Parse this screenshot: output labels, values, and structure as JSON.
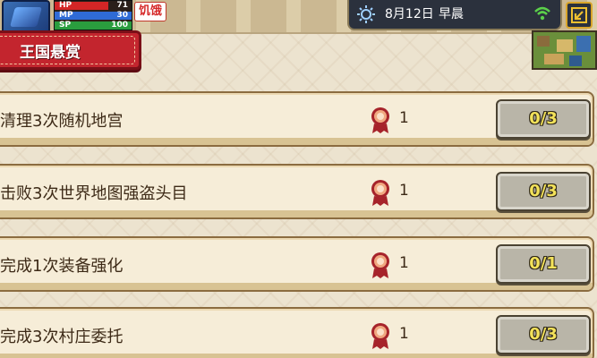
{
  "hud": {
    "hp_label": "HP",
    "hp_value": "71",
    "mp_label": "MP",
    "mp_value": "30",
    "sp_label": "SP",
    "sp_value": "100",
    "hunger": "饥饿"
  },
  "clock": {
    "date": "8月12日",
    "period": "早晨",
    "icon": "sun-icon"
  },
  "panel": {
    "title": "王国悬赏"
  },
  "quests": [
    {
      "name": "清理3次随机地宫",
      "reward_count": "1",
      "progress": "0/3"
    },
    {
      "name": "击败3次世界地图强盗头目",
      "reward_count": "1",
      "progress": "0/3"
    },
    {
      "name": "完成1次装备强化",
      "reward_count": "1",
      "progress": "0/1"
    },
    {
      "name": "完成3次村庄委托",
      "reward_count": "1",
      "progress": "0/3"
    }
  ],
  "colors": {
    "banner_red": "#c3252e",
    "progress_text": "#f3e25a",
    "hp_bar": "#d32626",
    "mp_bar": "#2f6bd6",
    "sp_bar": "#2a9d3e"
  }
}
